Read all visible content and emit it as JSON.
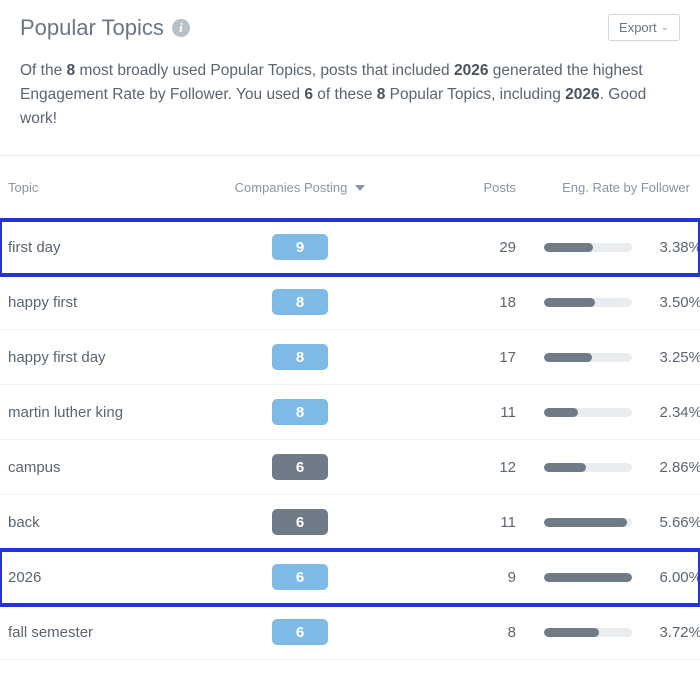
{
  "header": {
    "title": "Popular Topics",
    "export_label": "Export"
  },
  "summary": {
    "prefix": "Of the ",
    "count_broad": "8",
    "mid1": " most broadly used Popular Topics, posts that included ",
    "top_topic": "2026",
    "mid2": " generated the highest Engagement Rate by Follower. You used ",
    "used_count": "6",
    "mid3": " of these ",
    "total_count": "8",
    "mid4": " Popular Topics, including ",
    "top_topic2": "2026",
    "tail": ". Good work!"
  },
  "columns": {
    "topic": "Topic",
    "companies": "Companies Posting",
    "posts": "Posts",
    "eng": "Eng. Rate by Follower"
  },
  "chart_data": {
    "type": "table",
    "title": "Popular Topics",
    "columns": [
      "Topic",
      "Companies Posting",
      "Posts",
      "Eng. Rate by Follower (%)"
    ],
    "rows": [
      [
        "first day",
        9,
        29,
        3.38
      ],
      [
        "happy first",
        8,
        18,
        3.5
      ],
      [
        "happy first day",
        8,
        17,
        3.25
      ],
      [
        "martin luther king",
        8,
        11,
        2.34
      ],
      [
        "campus",
        6,
        12,
        2.86
      ],
      [
        "back",
        6,
        11,
        5.66
      ],
      [
        "2026",
        6,
        9,
        6.0
      ],
      [
        "fall semester",
        6,
        8,
        3.72
      ]
    ]
  },
  "rows": [
    {
      "topic": "first day",
      "companies": "9",
      "pill": "blue",
      "posts": "29",
      "eng": "3.38%",
      "bar": 56,
      "highlight": true
    },
    {
      "topic": "happy first",
      "companies": "8",
      "pill": "blue",
      "posts": "18",
      "eng": "3.50%",
      "bar": 58,
      "highlight": false
    },
    {
      "topic": "happy first day",
      "companies": "8",
      "pill": "blue",
      "posts": "17",
      "eng": "3.25%",
      "bar": 54,
      "highlight": false
    },
    {
      "topic": "martin luther king",
      "companies": "8",
      "pill": "blue",
      "posts": "11",
      "eng": "2.34%",
      "bar": 39,
      "highlight": false
    },
    {
      "topic": "campus",
      "companies": "6",
      "pill": "gray",
      "posts": "12",
      "eng": "2.86%",
      "bar": 48,
      "highlight": false
    },
    {
      "topic": "back",
      "companies": "6",
      "pill": "gray",
      "posts": "11",
      "eng": "5.66%",
      "bar": 94,
      "highlight": false
    },
    {
      "topic": "2026",
      "companies": "6",
      "pill": "blue",
      "posts": "9",
      "eng": "6.00%",
      "bar": 100,
      "highlight": true
    },
    {
      "topic": "fall semester",
      "companies": "6",
      "pill": "blue",
      "posts": "8",
      "eng": "3.72%",
      "bar": 62,
      "highlight": false
    }
  ]
}
